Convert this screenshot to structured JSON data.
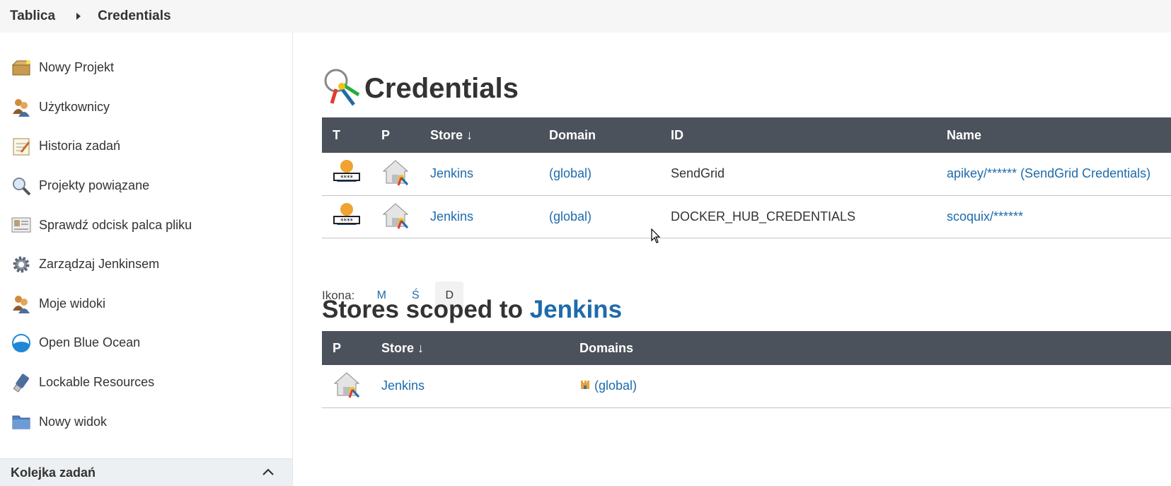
{
  "breadcrumb": {
    "items": [
      "Tablica",
      "Credentials"
    ]
  },
  "sidebar": {
    "items": [
      {
        "label": "Nowy Projekt",
        "icon": "package-icon"
      },
      {
        "label": "Użytkownicy",
        "icon": "users-icon"
      },
      {
        "label": "Historia zadań",
        "icon": "notepad-icon"
      },
      {
        "label": "Projekty powiązane",
        "icon": "magnifier-icon"
      },
      {
        "label": "Sprawdź odcisk palca pliku",
        "icon": "fingerprint-icon"
      },
      {
        "label": "Zarządzaj Jenkinsem",
        "icon": "gear-icon"
      },
      {
        "label": "Moje widoki",
        "icon": "users-icon"
      },
      {
        "label": "Open Blue Ocean",
        "icon": "blue-ocean-icon"
      },
      {
        "label": "Lockable Resources",
        "icon": "usb-drive-icon"
      },
      {
        "label": "Nowy widok",
        "icon": "folder-icon"
      }
    ],
    "queue_label": "Kolejka zadań"
  },
  "main": {
    "title": "Credentials",
    "credentials_table": {
      "headers": {
        "t": "T",
        "p": "P",
        "store": "Store ↓",
        "domain": "Domain",
        "id": "ID",
        "name": "Name"
      },
      "rows": [
        {
          "store": "Jenkins",
          "domain": "(global)",
          "id": "SendGrid",
          "name": "apikey/****** (SendGrid Credentials)"
        },
        {
          "store": "Jenkins",
          "domain": "(global)",
          "id": "DOCKER_HUB_CREDENTIALS",
          "name": "scoquix/******"
        }
      ]
    },
    "icon_size": {
      "label": "Ikona:",
      "options": [
        "M",
        "Ś",
        "D"
      ],
      "selected": "D"
    },
    "stores_title_prefix": "Stores scoped to",
    "stores_title_link": "Jenkins",
    "stores_table": {
      "headers": {
        "p": "P",
        "store": "Store ↓",
        "domains": "Domains"
      },
      "rows": [
        {
          "store": "Jenkins",
          "domain": "(global)"
        }
      ]
    }
  },
  "colors": {
    "header_bg": "#4b525b",
    "link": "#1e6bab",
    "breadcrumb_bg": "#f6f6f6"
  }
}
